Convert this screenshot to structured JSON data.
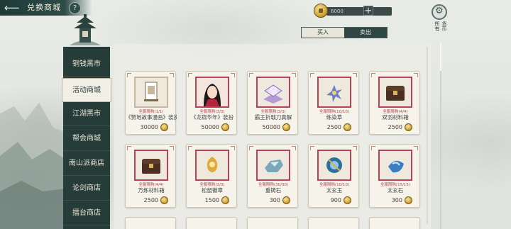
{
  "header": {
    "title": "兑换商城",
    "help": "?"
  },
  "currency": {
    "value": "6000",
    "plus": "+"
  },
  "tabs": {
    "buy": "买入",
    "sell": "卖出"
  },
  "side_toggle": {
    "col1": "货币",
    "col2": "所有"
  },
  "nav": [
    {
      "label": "铜钱黑市",
      "active": false
    },
    {
      "label": "活动商城",
      "active": true
    },
    {
      "label": "江湖黑市",
      "active": false
    },
    {
      "label": "帮会商城",
      "active": false
    },
    {
      "label": "南山派商店",
      "active": false
    },
    {
      "label": "论剑商店",
      "active": false
    },
    {
      "label": "擂台商店",
      "active": false
    }
  ],
  "items": [
    {
      "limit": "全服限购(1/1)",
      "name": "《赞地故事漫画》装扮",
      "price": "30000",
      "icon": "scroll-frame-icon"
    },
    {
      "limit": "全服限购(3/3)",
      "name": "《龙锦华年》装扮",
      "price": "50000",
      "icon": "character-portrait"
    },
    {
      "limit": "全服限购(3/3)",
      "name": "霸王折戟刀真解",
      "price": "50000",
      "icon": "book-icon"
    },
    {
      "limit": "全服限购(10/10)",
      "name": "练染草",
      "price": "2500",
      "icon": "flower-icon"
    },
    {
      "limit": "全服限购(4/4)",
      "name": "双羽材料箱",
      "price": "2500",
      "icon": "chest-icon"
    },
    {
      "limit": "全服限购(4/4)",
      "name": "万炼材料箱",
      "price": "2500",
      "icon": "chest-icon"
    },
    {
      "limit": "全服限购(3/3)",
      "name": "松鼠徽章",
      "price": "1500",
      "icon": "badge-icon"
    },
    {
      "limit": "全服限购(30/30)",
      "name": "重铸石",
      "price": "300",
      "icon": "stone-icon"
    },
    {
      "limit": "全服限购(10/10)",
      "name": "太玄玉",
      "price": "900",
      "icon": "jade-icon"
    },
    {
      "limit": "全服限购(15/15)",
      "name": "太玄石",
      "price": "300",
      "icon": "gem-icon"
    }
  ]
}
